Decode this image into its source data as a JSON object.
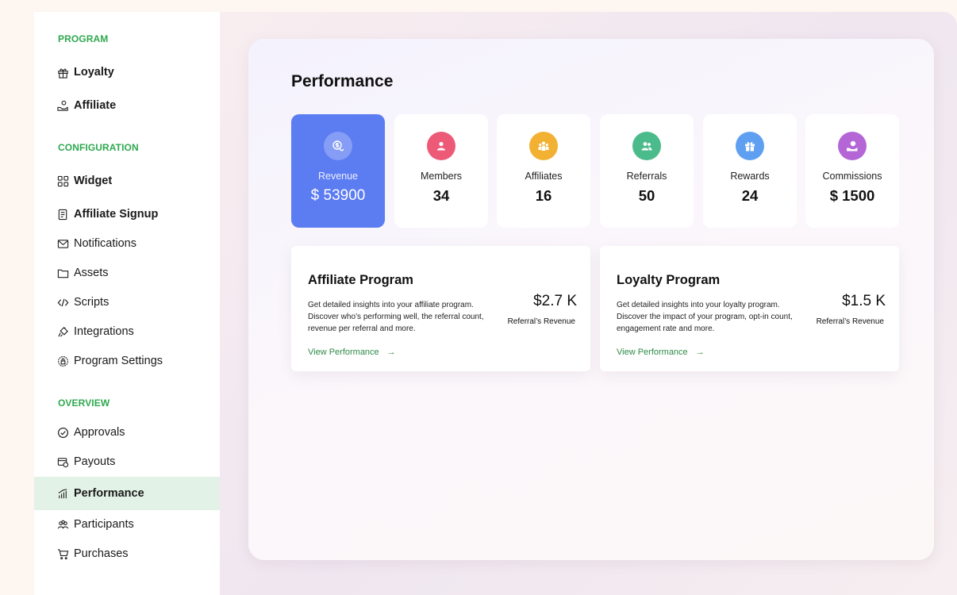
{
  "sidebar": {
    "sections": {
      "program": "PROGRAM",
      "configuration": "CONFIGURATION",
      "overview": "OVERVIEW"
    },
    "items": {
      "loyalty": "Loyalty",
      "affiliate": "Affiliate",
      "widget": "Widget",
      "affiliate_signup": "Affiliate Signup",
      "notifications": "Notifications",
      "assets": "Assets",
      "scripts": "Scripts",
      "integrations": "Integrations",
      "program_settings": "Program Settings",
      "approvals": "Approvals",
      "payouts": "Payouts",
      "performance": "Performance",
      "participants": "Participants",
      "purchases": "Purchases"
    },
    "active_item": "performance"
  },
  "main": {
    "title": "Performance",
    "stats": [
      {
        "label": "Revenue",
        "value": "$ 53900",
        "icon": "revenue-icon",
        "color": "#5c7cf2"
      },
      {
        "label": "Members",
        "value": "34",
        "icon": "member-icon",
        "color": "#ec5a78"
      },
      {
        "label": "Affiliates",
        "value": "16",
        "icon": "group-icon",
        "color": "#f2b133"
      },
      {
        "label": "Referrals",
        "value": "50",
        "icon": "referral-icon",
        "color": "#4cbb8c"
      },
      {
        "label": "Rewards",
        "value": "24",
        "icon": "gift-icon",
        "color": "#5f9ff2"
      },
      {
        "label": "Commissions",
        "value": "$ 1500",
        "icon": "commission-icon",
        "color": "#b466d6"
      }
    ],
    "programs": [
      {
        "title": "Affiliate Program",
        "description": "Get detailed insights into your affiliate program. Discover who’s performing well, the referral count, revenue per referral and more.",
        "amount": "$2.7 K",
        "amount_label": "Referral’s Revenue",
        "link": "View Performance"
      },
      {
        "title": "Loyalty Program",
        "description": "Get detailed insights into your loyalty program. Discover the impact of your program, opt-in count, engagement rate and more.",
        "amount": "$1.5 K",
        "amount_label": "Referral’s Revenue",
        "link": "View Performance"
      }
    ]
  },
  "colors": {
    "accent_green": "#2fa84f",
    "active_bg": "#e3f2e6",
    "primary_card": "#5c7cf2"
  }
}
